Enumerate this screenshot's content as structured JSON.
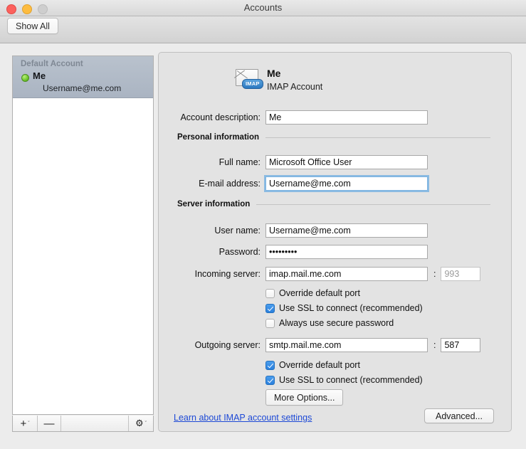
{
  "window": {
    "title": "Accounts",
    "traffic_lights": [
      "close-red",
      "minimize-yellow",
      "zoom-disabled"
    ]
  },
  "toolbar": {
    "show_all_label": "Show All"
  },
  "sidebar": {
    "group_label": "Default Account",
    "accounts": [
      {
        "name": "Me",
        "email": "Username@me.com",
        "status": "online",
        "selected": true
      }
    ],
    "footer": {
      "add_label": "+",
      "add_chevron": "ˇ",
      "remove_label": "—",
      "gear_label": "⚙",
      "gear_chevron": "ˇ"
    }
  },
  "detail": {
    "account_title": "Me",
    "account_subtitle": "IMAP Account",
    "icon_badge": "IMAP",
    "fields": {
      "account_description": {
        "label": "Account description:",
        "value": "Me"
      },
      "full_name": {
        "label": "Full name:",
        "value": "Microsoft Office User"
      },
      "email_address": {
        "label": "E-mail address:",
        "value": "Username@me.com"
      },
      "user_name": {
        "label": "User name:",
        "value": "Username@me.com"
      },
      "password": {
        "label": "Password:",
        "value": "•••••••••"
      },
      "incoming_server": {
        "label": "Incoming server:",
        "value": "imap.mail.me.com",
        "port": "993",
        "port_separator": ":"
      },
      "outgoing_server": {
        "label": "Outgoing server:",
        "value": "smtp.mail.me.com",
        "port": "587",
        "port_separator": ":"
      }
    },
    "groups": {
      "personal_information": "Personal information",
      "server_information": "Server information"
    },
    "incoming_options": [
      {
        "label": "Override default port",
        "checked": false
      },
      {
        "label": "Use SSL to connect (recommended)",
        "checked": true
      },
      {
        "label": "Always use secure password",
        "checked": false
      }
    ],
    "outgoing_options": [
      {
        "label": "Override default port",
        "checked": true
      },
      {
        "label": "Use SSL to connect (recommended)",
        "checked": true
      }
    ],
    "more_options_label": "More Options...",
    "learn_link": "Learn about IMAP account settings",
    "advanced_label": "Advanced..."
  },
  "colors": {
    "accent": "#2b80dd",
    "link": "#1d49d6",
    "status_online": "#6fc52b",
    "selection": "#b0bac7"
  }
}
